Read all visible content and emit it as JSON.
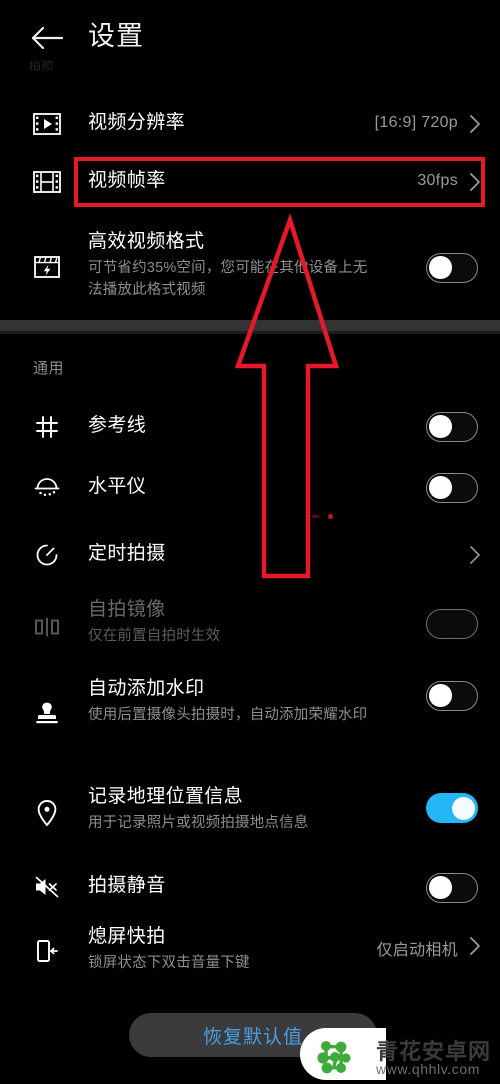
{
  "header": {
    "back_icon": "arrow-left-icon",
    "title": "设置",
    "faint_label": "拍照"
  },
  "video_section": {
    "rows": [
      {
        "icon": "video-resolution-icon",
        "title": "视频分辨率",
        "value": "[16:9] 720p",
        "chevron": "chevron-right-icon"
      },
      {
        "icon": "video-framerate-icon",
        "title": "视频帧率",
        "value": "30fps",
        "chevron": "chevron-right-icon"
      },
      {
        "icon": "efficient-video-icon",
        "title": "高效视频格式",
        "subtitle": "可节省约35%空间，您可能在其他设备上无法播放此格式视频",
        "toggle": "off"
      }
    ]
  },
  "general_section": {
    "label": "通用",
    "rows": [
      {
        "icon": "grid-lines-icon",
        "title": "参考线",
        "toggle": "off"
      },
      {
        "icon": "level-meter-icon",
        "title": "水平仪",
        "toggle": "off"
      },
      {
        "icon": "timer-icon",
        "title": "定时拍摄",
        "chevron": "chevron-right-icon"
      },
      {
        "icon": "mirror-icon",
        "title": "自拍镜像",
        "subtitle": "仅在前置自拍时生效",
        "toggle": "off",
        "disabled": true
      },
      {
        "icon": "watermark-stamp-icon",
        "title": "自动添加水印",
        "subtitle": "使用后置摄像头拍摄时，自动添加荣耀水印",
        "toggle": "off"
      },
      {
        "icon": "location-pin-icon",
        "title": "记录地理位置信息",
        "subtitle": "用于记录照片或视频拍摄地点信息",
        "toggle": "on"
      },
      {
        "icon": "mute-icon",
        "title": "拍摄静音",
        "toggle": "off"
      },
      {
        "icon": "screen-off-capture-icon",
        "title": "熄屏快拍",
        "subtitle": "锁屏状态下双击音量下键",
        "value": "仅启动相机",
        "chevron": "chevron-right-icon"
      }
    ]
  },
  "footer": {
    "restore_label": "恢复默认值"
  },
  "annotations": {
    "highlight_target": "视频帧率",
    "arrow_icon": "up-arrow-annotation"
  },
  "watermark": {
    "site_name": "青花安卓网",
    "url": "www.qhhlv.com",
    "logo_icon": "molecule-logo-icon"
  },
  "colors": {
    "background": "#000000",
    "accent_blue": "#23b7f5",
    "annotation_red": "#e8182b",
    "restore_text": "#4a9fe0",
    "logo_green": "#3faa3c"
  }
}
